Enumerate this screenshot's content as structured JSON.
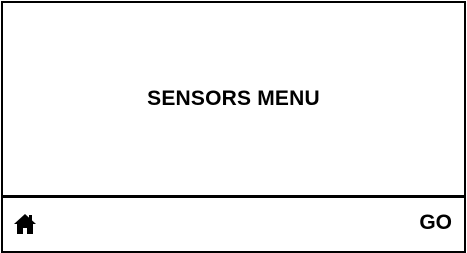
{
  "screen": {
    "title": "SENSORS MENU"
  },
  "softkeys": {
    "left_icon": "home-icon",
    "right_label": "GO"
  }
}
